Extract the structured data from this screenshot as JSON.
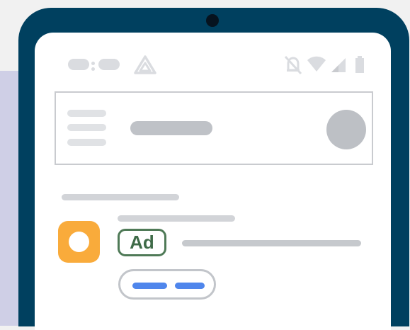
{
  "ad": {
    "badge_label": "Ad"
  },
  "icons": {
    "status_left": [
      "cast-connected-icon",
      "app-triangle-icon"
    ],
    "status_right": [
      "bell-off-icon",
      "wifi-icon",
      "signal-icon",
      "battery-icon"
    ]
  },
  "colors": {
    "phone_frame": "#00405f",
    "screen": "#ffffff",
    "app_icon": "#f9ab3b",
    "ad_badge": "#4f7a57",
    "chip_accent": "#4f86ec",
    "placeholder": "#bfc2c7"
  }
}
